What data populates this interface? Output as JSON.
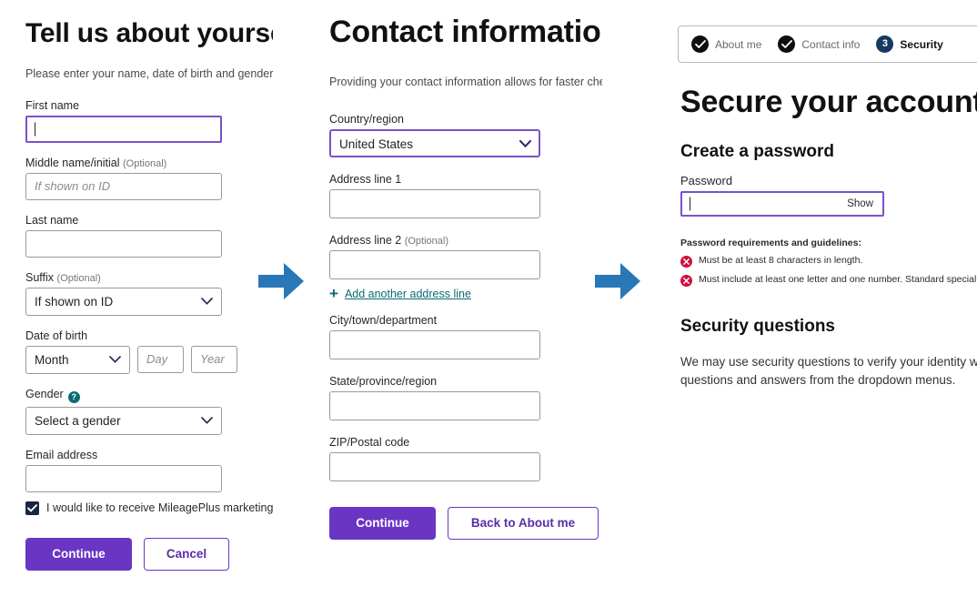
{
  "panel_about": {
    "title": "Tell us about yourself",
    "subtitle": "Please enter your name, date of birth and gender",
    "first_name": {
      "label": "First name",
      "value": "",
      "placeholder": ""
    },
    "middle_name": {
      "label": "Middle name/initial",
      "optional": "(Optional)",
      "value": "",
      "placeholder": "If shown on ID"
    },
    "last_name": {
      "label": "Last name",
      "value": "",
      "placeholder": ""
    },
    "suffix": {
      "label": "Suffix",
      "optional": "(Optional)",
      "value": "If shown on ID"
    },
    "dob": {
      "label": "Date of birth",
      "month_value": "Month",
      "day_placeholder": "Day",
      "year_placeholder": "Year"
    },
    "gender": {
      "label": "Gender",
      "help_icon": "question-mark-icon",
      "value": "Select a gender"
    },
    "email": {
      "label": "Email address",
      "value": "",
      "placeholder": ""
    },
    "marketing_optin": {
      "checked": true,
      "text": "I would like to receive MileagePlus marketing e"
    },
    "continue_label": "Continue",
    "cancel_label": "Cancel"
  },
  "panel_contact": {
    "title": "Contact information",
    "subtitle": "Providing your contact information allows for faster checko",
    "country": {
      "label": "Country/region",
      "value": "United States"
    },
    "address1": {
      "label": "Address line 1",
      "value": "",
      "placeholder": ""
    },
    "address2": {
      "label": "Address line 2",
      "optional": "(Optional)",
      "value": "",
      "placeholder": ""
    },
    "add_line": {
      "icon": "plus-icon",
      "text": "Add another address line"
    },
    "city": {
      "label": "City/town/department",
      "value": "",
      "placeholder": ""
    },
    "state": {
      "label": "State/province/region",
      "value": "",
      "placeholder": ""
    },
    "zip": {
      "label": "ZIP/Postal code",
      "value": "",
      "placeholder": ""
    },
    "continue_label": "Continue",
    "back_label": "Back to About me"
  },
  "panel_security": {
    "stepper": [
      {
        "label": "About me",
        "state": "done",
        "icon": "check-circle-icon"
      },
      {
        "label": "Contact info",
        "state": "done",
        "icon": "check-circle-icon"
      },
      {
        "label": "Security",
        "state": "current",
        "number": "3"
      }
    ],
    "title": "Secure your account",
    "create_password_title": "Create a password",
    "password": {
      "label": "Password",
      "value": "",
      "show_label": "Show"
    },
    "requirements_title": "Password requirements and guidelines:",
    "requirements": [
      {
        "icon": "x-circle-icon",
        "text": "Must be at least 8 characters in length."
      },
      {
        "icon": "x-circle-icon",
        "text": "Must include at least one letter and one number. Standard special cha"
      }
    ],
    "security_questions_title": "Security questions",
    "security_questions_body": "We may use security questions to verify your identity wh questions and answers from the dropdown menus.",
    "security_questions_line1": "We may use security questions to verify your identity wh",
    "security_questions_line2": "questions and answers from the dropdown menus."
  },
  "arrows": [
    {
      "name": "arrow-about-to-contact",
      "direction": "right"
    },
    {
      "name": "arrow-contact-to-security",
      "direction": "right"
    }
  ],
  "colors": {
    "purple": "#6b35c4",
    "purple_focus": "#7a52c7",
    "teal": "#0a6b75",
    "navy": "#153a63",
    "arrow_blue": "#2878b8",
    "red": "#d0103a",
    "checkbox_navy": "#16273f"
  }
}
